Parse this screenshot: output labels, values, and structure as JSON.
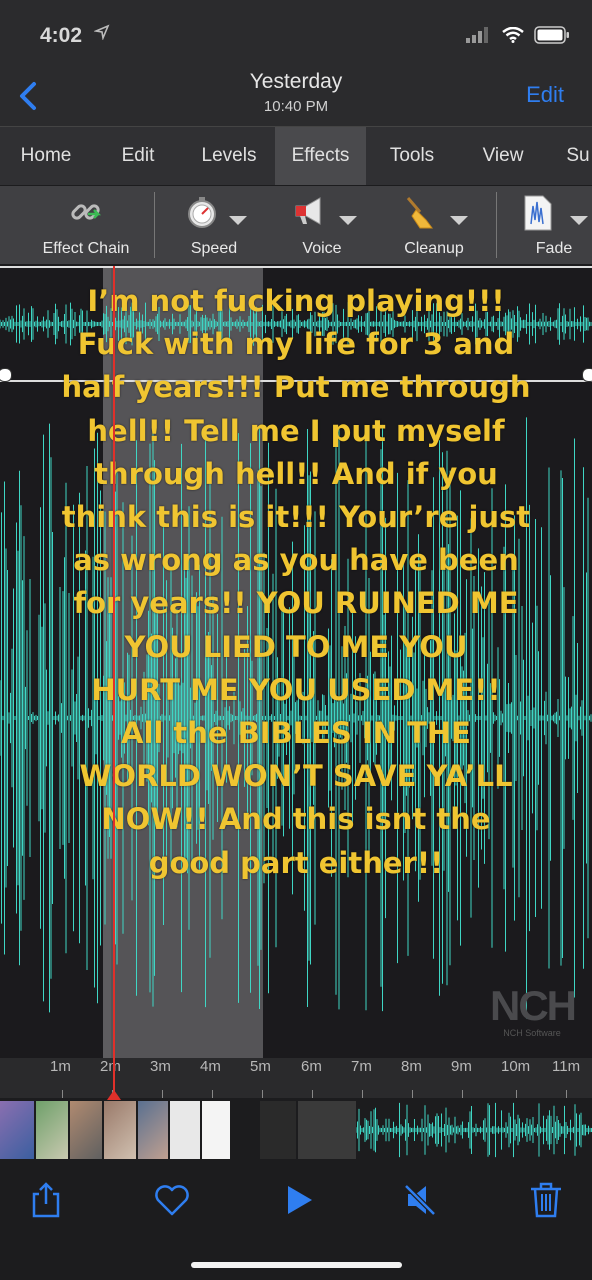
{
  "status": {
    "time": "4:02",
    "location_icon": "location-arrow-icon",
    "signal_icon": "cellular-signal-icon",
    "wifi_icon": "wifi-icon",
    "battery_icon": "battery-icon"
  },
  "nav": {
    "back_icon": "chevron-left-icon",
    "title": "Yesterday",
    "subtitle": "10:40 PM",
    "edit_label": "Edit"
  },
  "menu": {
    "items": [
      "Home",
      "Edit",
      "Levels",
      "Effects",
      "Tools",
      "View",
      "Su"
    ],
    "active": "Effects"
  },
  "toolbar": {
    "effect_chain": "Effect Chain",
    "speed": "Speed",
    "voice": "Voice",
    "cleanup": "Cleanup",
    "fade": "Fade"
  },
  "overlay": {
    "lines": [
      "I’m not fucking playing!!!",
      "Fuck with my life for 3 and",
      "half years!!! Put me through",
      "hell!! Tell me I put myself",
      "through hell!! And if you",
      "think this is it!!! Your’re just",
      "as wrong as you have been",
      "for years!! YOU RUINED ME",
      "YOU LIED TO ME YOU",
      "HURT ME YOU USED ME!!",
      "All the BIBLES IN THE",
      "WORLD WON’T SAVE YA’LL",
      "NOW!! And this isnt the",
      "good part either!!"
    ]
  },
  "watermark": {
    "big": "NCH",
    "small": "NCH Software"
  },
  "timeline": {
    "labels": [
      "1m",
      "2m",
      "3m",
      "4m",
      "5m",
      "6m",
      "7m",
      "8m",
      "9m",
      "10m",
      "11m"
    ]
  },
  "bottom": {
    "share_icon": "share-icon",
    "favorite_icon": "heart-icon",
    "play_icon": "play-icon",
    "mute_icon": "speaker-mute-icon",
    "delete_icon": "trash-icon"
  },
  "colors": {
    "accent": "#2f7ef0",
    "waveform": "#3fd6c4",
    "overlay_text": "#f0c531",
    "cursor": "#e0302a"
  }
}
